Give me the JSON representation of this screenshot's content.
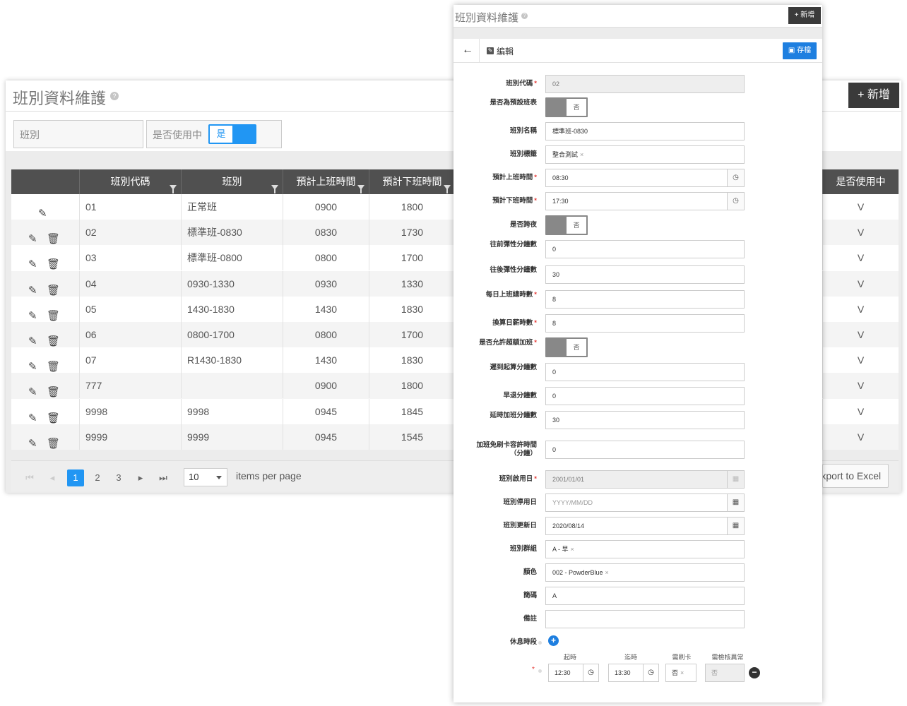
{
  "list_window": {
    "title": "班別資料維護",
    "help_icon": "?",
    "add_button": "+ 新增",
    "filters": {
      "shift_placeholder": "班別",
      "in_use_label": "是否使用中",
      "in_use_value": "是"
    },
    "columns": [
      "班別代碼",
      "班別",
      "預計上班時間",
      "預計下班時間",
      "是否使用中"
    ],
    "rows": [
      {
        "code": "01",
        "name": "正常班",
        "start": "0900",
        "end": "1800",
        "in_use": "V"
      },
      {
        "code": "02",
        "name": "標準班-0830",
        "start": "0830",
        "end": "1730",
        "in_use": "V"
      },
      {
        "code": "03",
        "name": "標準班-0800",
        "start": "0800",
        "end": "1700",
        "in_use": "V"
      },
      {
        "code": "04",
        "name": "0930-1330",
        "start": "0930",
        "end": "1330",
        "in_use": "V"
      },
      {
        "code": "05",
        "name": "1430-1830",
        "start": "1430",
        "end": "1830",
        "in_use": "V"
      },
      {
        "code": "06",
        "name": "0800-1700",
        "start": "0800",
        "end": "1700",
        "in_use": "V"
      },
      {
        "code": "07",
        "name": "R1430-1830",
        "start": "1430",
        "end": "1830",
        "in_use": "V"
      },
      {
        "code": "777",
        "name": "",
        "start": "0900",
        "end": "1800",
        "in_use": "V"
      },
      {
        "code": "9998",
        "name": "9998",
        "start": "0945",
        "end": "1845",
        "in_use": "V"
      },
      {
        "code": "9999",
        "name": "9999",
        "start": "0945",
        "end": "1545",
        "in_use": "V"
      }
    ],
    "pager": {
      "pages": [
        "1",
        "2",
        "3"
      ],
      "per_page": "10",
      "per_page_label": "items per page",
      "export_label": "Export to Excel"
    }
  },
  "edit_window": {
    "title": "班別資料維護",
    "help_icon": "?",
    "add_button": "+ 新增",
    "toolbar": {
      "back_icon": "←",
      "edit_label": "編輯",
      "save_label": "存檔"
    },
    "fields": [
      {
        "label": "班別代碼",
        "required": true,
        "type": "input",
        "value": "02",
        "disabled": true
      },
      {
        "label": "是否為預設班表",
        "required": false,
        "type": "toggle",
        "value": "否"
      },
      {
        "label": "班別名稱",
        "required": false,
        "type": "input",
        "value": "標準班-0830"
      },
      {
        "label": "班別標籤",
        "required": false,
        "type": "tag",
        "value": "整合測試"
      },
      {
        "label": "預計上班時間",
        "required": true,
        "type": "time",
        "value": "08:30"
      },
      {
        "label": "預計下班時間",
        "required": true,
        "type": "time",
        "value": "17:30"
      },
      {
        "label": "是否跨夜",
        "required": false,
        "type": "toggle",
        "value": "否"
      },
      {
        "label": "往前彈性分鐘數",
        "required": false,
        "type": "input",
        "value": "0"
      },
      {
        "label": "往後彈性分鐘數",
        "required": false,
        "type": "input",
        "value": "30"
      },
      {
        "label": "每日上班總時數",
        "required": true,
        "type": "input",
        "value": "8"
      },
      {
        "label": "換算日薪時數",
        "required": true,
        "type": "input",
        "value": "8"
      },
      {
        "label": "是否允許超額加班",
        "required": true,
        "type": "toggle",
        "value": "否"
      },
      {
        "label": "遲到起算分鐘數",
        "required": false,
        "type": "input",
        "value": "0"
      },
      {
        "label": "早退分鐘數",
        "required": false,
        "type": "input",
        "value": "0"
      },
      {
        "label": "延時加班分鐘數",
        "required": false,
        "type": "input",
        "value": "30"
      },
      {
        "label": "加班免刷卡容許時間（分鐘）",
        "required": false,
        "type": "input",
        "value": "0"
      },
      {
        "label": "班別啟用日",
        "required": true,
        "type": "date",
        "value": "2001/01/01",
        "disabled": true
      },
      {
        "label": "班別停用日",
        "required": false,
        "type": "date",
        "value": "",
        "placeholder": "YYYY/MM/DD"
      },
      {
        "label": "班別更新日",
        "required": false,
        "type": "date",
        "value": "2020/08/14"
      },
      {
        "label": "班別群組",
        "required": false,
        "type": "tag",
        "value": "A - 早"
      },
      {
        "label": "顏色",
        "required": false,
        "type": "tag",
        "value": "002 - PowderBlue"
      },
      {
        "label": "簡碼",
        "required": false,
        "type": "input",
        "value": "A"
      },
      {
        "label": "備註",
        "required": false,
        "type": "input",
        "value": ""
      }
    ],
    "break_section": {
      "label": "休息時段",
      "headers": [
        "起時",
        "迄時",
        "需刷卡",
        "需檢核異常"
      ],
      "start": "12:30",
      "end": "13:30",
      "need_card": "否",
      "check_abnormal": "否"
    }
  },
  "colors": {
    "accent": "#2196f3",
    "dark": "#3a3a3a",
    "header": "#505050",
    "required": "#e53935"
  }
}
